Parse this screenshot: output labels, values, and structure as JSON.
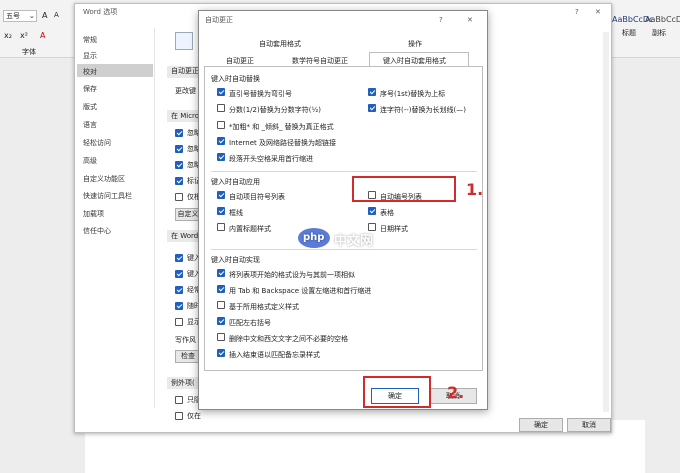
{
  "word": {
    "font_name": "五号",
    "group_font": "字体",
    "style_preview_1": "AaBbCcDc",
    "style_preview_2": "AaBbCcDc",
    "style_name_1": "标题",
    "style_name_2": "副标",
    "toolbar_glyphs": [
      "x₂",
      "x²",
      "A"
    ]
  },
  "options_dialog": {
    "title": "Word 选项",
    "help": "?",
    "close": "✕",
    "nav": [
      "常规",
      "显示",
      "校对",
      "保存",
      "版式",
      "语言",
      "轻松访问",
      "高级",
      "自定义功能区",
      "快速访问工具栏",
      "加载项",
      "信任中心"
    ],
    "selected_index": 2,
    "sec1": "自动更正",
    "sec1_text": "更改键",
    "sec2": "在 Micro",
    "sec2_items": [
      "忽略",
      "忽略",
      "忽略",
      "标记",
      "仅根"
    ],
    "sec2_checked": [
      true,
      true,
      true,
      true,
      false
    ],
    "custom_btn": "自定义",
    "sec3": "在 Word",
    "sec3_items": [
      "键入",
      "键入",
      "经常",
      "随时",
      "显示"
    ],
    "sec3_checked": [
      true,
      true,
      true,
      true,
      false
    ],
    "writing_style": "写作风",
    "check_btn": "检查",
    "exceptions": "例外项(",
    "exc_items": [
      "只隐",
      "仅在"
    ],
    "ok": "确定",
    "cancel": "取消"
  },
  "autocorrect": {
    "title": "自动更正",
    "help": "?",
    "close": "✕",
    "tabs_row1": [
      "自动套用格式",
      "操作"
    ],
    "tabs_row2": [
      "自动更正",
      "数学符号自动更正",
      "键入时自动套用格式"
    ],
    "group_replace": "键入时自动替换",
    "replace_left": [
      {
        "label": "直引号替换为弯引号",
        "checked": true
      },
      {
        "label": "分数(1/2)替换为分数字符(½)",
        "checked": false
      },
      {
        "label": "*加粗* 和 _倾斜_ 替换为真正格式",
        "checked": false
      },
      {
        "label": "Internet 及网络路径替换为超链接",
        "checked": true
      },
      {
        "label": "段落开头空格采用首行缩进",
        "checked": true
      }
    ],
    "replace_right": [
      {
        "label": "序号(1st)替换为上标",
        "checked": true
      },
      {
        "label": "连字符(--)替换为长划线(—)",
        "checked": true
      }
    ],
    "group_apply": "键入时自动应用",
    "apply_left": [
      {
        "label": "自动项目符号列表",
        "checked": true
      },
      {
        "label": "框线",
        "checked": true
      },
      {
        "label": "内置标题样式",
        "checked": false
      }
    ],
    "apply_right": [
      {
        "label": "自动编号列表",
        "checked": false
      },
      {
        "label": "表格",
        "checked": true
      },
      {
        "label": "日期样式",
        "checked": false
      }
    ],
    "group_auto": "键入时自动实现",
    "auto_items": [
      {
        "label": "将列表项开始的格式设为与其前一项相似",
        "checked": true
      },
      {
        "label": "用 Tab 和 Backspace 设置左缩进和首行缩进",
        "checked": true
      },
      {
        "label": "基于所用格式定义样式",
        "checked": false
      },
      {
        "label": "匹配左右括号",
        "checked": true
      },
      {
        "label": "删除中文和西文文字之间不必要的空格",
        "checked": false
      },
      {
        "label": "插入结束语以匹配备忘录样式",
        "checked": true
      }
    ],
    "ok": "确定",
    "cancel": "取消"
  },
  "annotations": {
    "step1": "1.",
    "step2": "2."
  },
  "watermark": {
    "logo": "php",
    "text": "中文网"
  }
}
